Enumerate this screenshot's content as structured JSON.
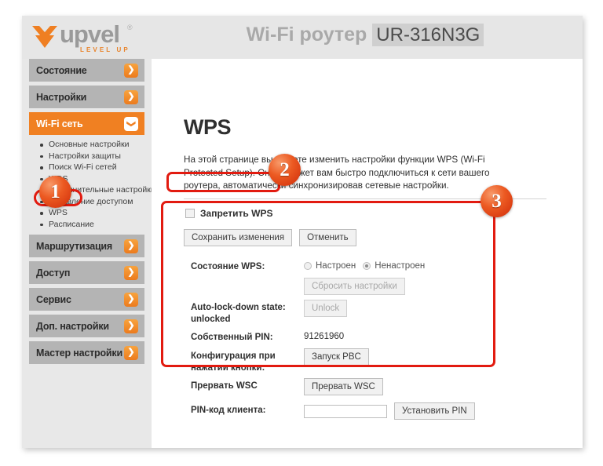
{
  "header": {
    "logo_word": "upvel",
    "logo_registered": "®",
    "logo_tagline": "LEVEL UP",
    "logo_icon": "upvel-chevron-logo",
    "title_prefix": "Wi-Fi роутер",
    "model": "UR-316N3G"
  },
  "sidebar": {
    "items": [
      {
        "label": "Состояние",
        "icon": "chevron-right-icon",
        "active": false
      },
      {
        "label": "Настройки",
        "icon": "chevron-right-icon",
        "active": false
      },
      {
        "label": "Wi-Fi сеть",
        "icon": "chevron-down-icon",
        "active": true
      },
      {
        "label": "Маршрутизация",
        "icon": "chevron-right-icon",
        "active": false
      },
      {
        "label": "Доступ",
        "icon": "chevron-right-icon",
        "active": false
      },
      {
        "label": "Сервис",
        "icon": "chevron-right-icon",
        "active": false
      },
      {
        "label": "Доп. настройки",
        "icon": "chevron-right-icon",
        "active": false
      },
      {
        "label": "Мастер настройки",
        "icon": "chevron-right-icon",
        "active": false
      }
    ],
    "submenu": [
      "Основные настройки",
      "Настройки защиты",
      "Поиск Wi-Fi сетей",
      "WDS",
      "Дополнительные настройки",
      "Управление доступом",
      "WPS",
      "Расписание"
    ],
    "arrow_right_glyph": "❯",
    "arrow_down_glyph": "❯"
  },
  "main": {
    "title": "WPS",
    "description": "На этой странице вы можете изменить настройки функции WPS (Wi-Fi Protected Setup). Она поможет вам быстро подключиться к сети вашего роутера, автоматически синхронизировав сетевые настройки.",
    "disable_wps_label": "Запретить WPS",
    "disable_wps_checked": false,
    "save_label": "Сохранить изменения",
    "cancel_label": "Отменить",
    "settings": {
      "status_label": "Состояние WPS:",
      "status_option_configured": "Настроен",
      "status_option_unconfigured": "Ненастроен",
      "status_selected": "Ненастроен",
      "reset_button": "Сбросить настройки",
      "autolock_label": "Auto-lock-down state: unlocked",
      "unlock_button": "Unlock",
      "own_pin_label": "Собственный PIN:",
      "own_pin_value": "91261960",
      "pbc_label": "Конфигурация при нажатии кнопки:",
      "pbc_button": "Запуск PBC",
      "stop_wsc_label": "Прервать WSC",
      "stop_wsc_button": "Прервать WSC",
      "client_pin_label": "PIN-код клиента:",
      "client_pin_value": "",
      "client_pin_placeholder": "",
      "set_pin_button": "Установить PIN"
    }
  },
  "annotations": {
    "badges": [
      "1",
      "2",
      "3"
    ],
    "highlight_color": "#e21b10",
    "badge_color": "#ec5a22"
  }
}
